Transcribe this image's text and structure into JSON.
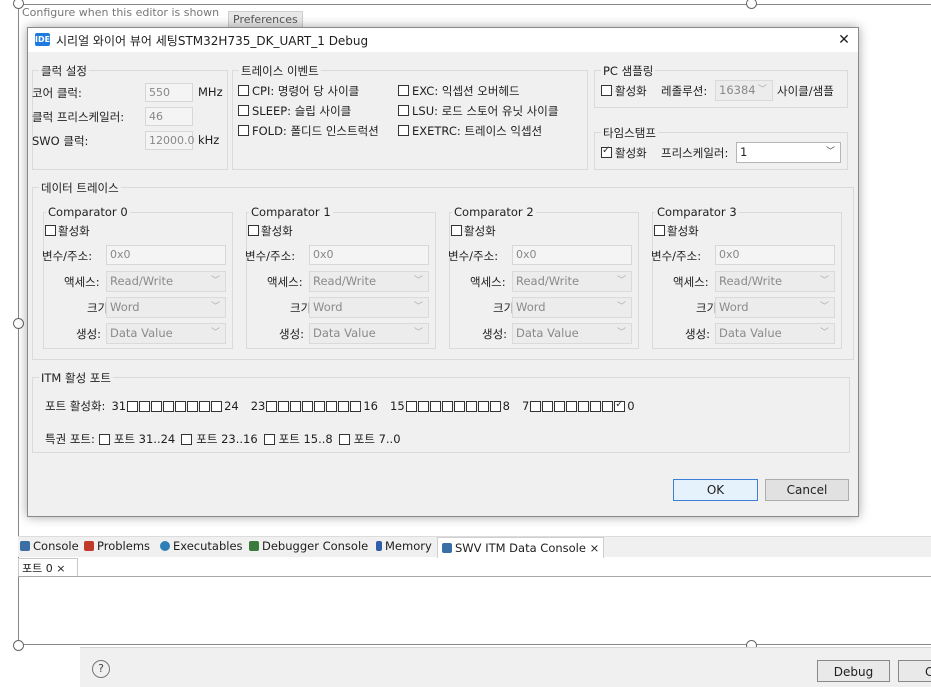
{
  "background": {
    "top_text": "Configure when this editor is shown",
    "top_button": "Preferences",
    "view_tabs": [
      {
        "label": "Console",
        "color": "#3a6ea5"
      },
      {
        "label": "Problems",
        "color": "#c0392b"
      },
      {
        "label": "Executables",
        "color": "#2e7fb8"
      },
      {
        "label": "Debugger Console",
        "color": "#3a7a3a"
      },
      {
        "label": "Memory",
        "color": "#2e5fa8"
      },
      {
        "label": "SWV ITM Data Console ×",
        "color": "#3a6ea5"
      }
    ],
    "port_tab": "포트 0 ×",
    "help": "?",
    "debug_button": "Debug",
    "c_button": "C"
  },
  "dialog": {
    "icon_text": "IDE",
    "title": "시리얼 와이어 뷰어 세팅STM32H735_DK_UART_1 Debug",
    "close": "✕",
    "clock": {
      "label": "클럭 설정",
      "core_label": "코어 클럭:",
      "core_value": "550",
      "core_unit": "MHz",
      "prescaler_label": "클럭 프리스케일러:",
      "prescaler_value": "46",
      "swo_label": "SWO 클럭:",
      "swo_value": "12000.0",
      "swo_unit": "kHz"
    },
    "trace_events": {
      "label": "트레이스 이벤트",
      "items": [
        {
          "label": "CPI: 명령어 당 사이클",
          "checked": false
        },
        {
          "label": "EXC: 익셉션 오버헤드",
          "checked": false
        },
        {
          "label": "SLEEP: 슬립 사이클",
          "checked": false
        },
        {
          "label": "LSU: 로드 스토어 유닛 사이클",
          "checked": false
        },
        {
          "label": "FOLD: 폴디드 인스트럭션",
          "checked": false
        },
        {
          "label": "EXETRC: 트레이스 익셉션",
          "checked": false
        }
      ]
    },
    "pc_sampling": {
      "label": "PC 샘플링",
      "enable_label": "활성화",
      "resolution_label": "레졸루션:",
      "resolution_value": "16384",
      "unit": "사이클/샘플"
    },
    "timestamp": {
      "label": "타임스탬프",
      "enable_label": "활성화",
      "prescaler_label": "프리스케일러:",
      "prescaler_value": "1"
    },
    "data_trace": {
      "label": "데이터 트레이스",
      "comparators": [
        {
          "title": "Comparator 0",
          "enable": "활성화",
          "addr_label": "변수/주소:",
          "addr": "0x0",
          "access_label": "액세스:",
          "access": "Read/Write",
          "size_label": "크기:",
          "size": "Word",
          "gen_label": "생성:",
          "gen": "Data Value"
        },
        {
          "title": "Comparator 1",
          "enable": "활성화",
          "addr_label": "변수/주소:",
          "addr": "0x0",
          "access_label": "액세스:",
          "access": "Read/Write",
          "size_label": "크기:",
          "size": "Word",
          "gen_label": "생성:",
          "gen": "Data Value"
        },
        {
          "title": "Comparator 2",
          "enable": "활성화",
          "addr_label": "변수/주소:",
          "addr": "0x0",
          "access_label": "액세스:",
          "access": "Read/Write",
          "size_label": "크기:",
          "size": "Word",
          "gen_label": "생성:",
          "gen": "Data Value"
        },
        {
          "title": "Comparator 3",
          "enable": "활성화",
          "addr_label": "변수/주소:",
          "addr": "0x0",
          "access_label": "액세스:",
          "access": "Read/Write",
          "size_label": "크기:",
          "size": "Word",
          "gen_label": "생성:",
          "gen": "Data Value"
        }
      ]
    },
    "itm": {
      "label": "ITM 활성 포트",
      "ports_label": "포트 활성화:",
      "groups": [
        {
          "start": "31",
          "end": "24",
          "checked_index": -1
        },
        {
          "start": "23",
          "end": "16",
          "checked_index": -1
        },
        {
          "start": "15",
          "end": "8",
          "checked_index": -1
        },
        {
          "start": "7",
          "end": "0",
          "checked_index": 7
        }
      ],
      "priv_label": "특권 포트:",
      "priv_items": [
        "포트 31..24",
        "포트 23..16",
        "포트 15..8",
        "포트 7..0"
      ]
    },
    "ok": "OK",
    "cancel": "Cancel"
  }
}
